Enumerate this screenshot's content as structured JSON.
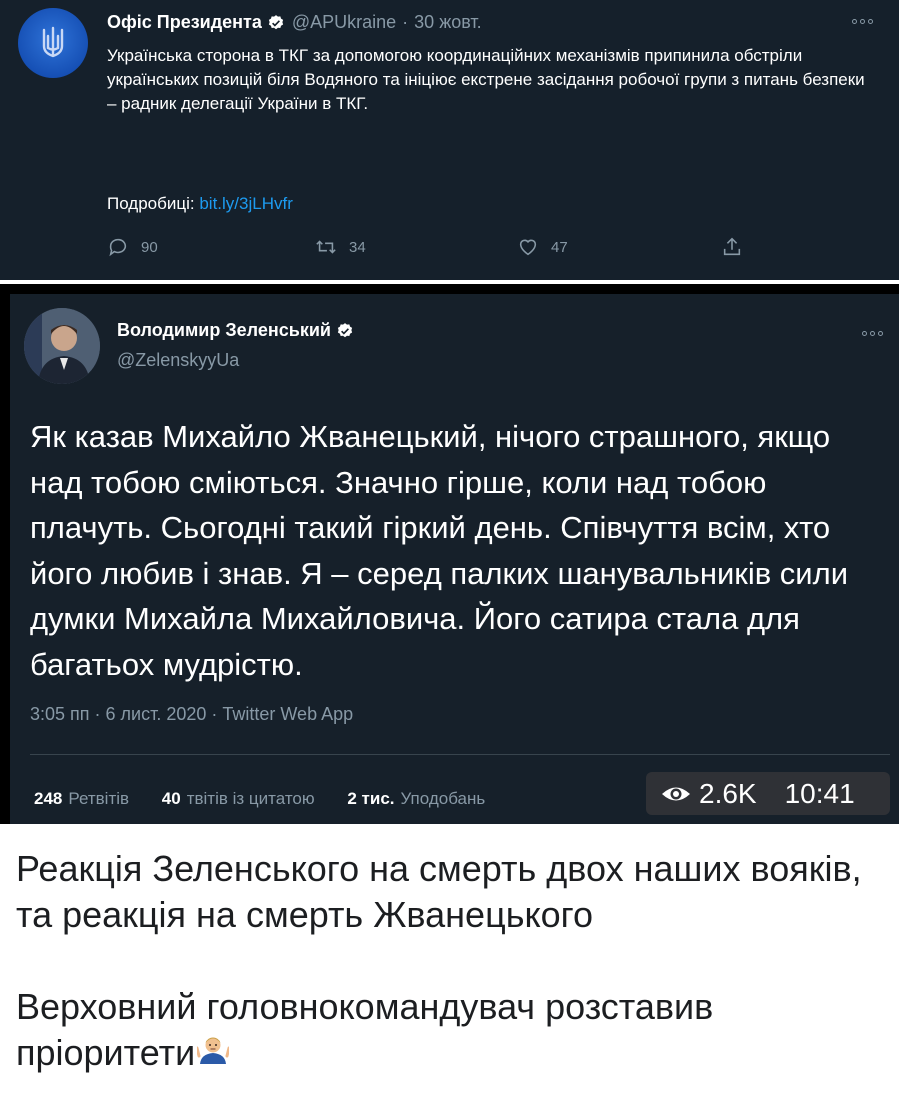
{
  "tweet1": {
    "name": "Офіс Президента",
    "handle": "@APUkraine",
    "separator": "·",
    "date": "30 жовт.",
    "body": "Українська сторона в ТКГ за допомогою координаційних механізмів припинила обстріли українських позицій біля Водяного та ініціює екстрене засідання робочої групи з питань безпеки – радник делегації України в ТКГ.",
    "more_label": "Подробиці:",
    "link": "bit.ly/3jLHvfr",
    "replies": "90",
    "retweets": "34",
    "likes": "47"
  },
  "tweet2": {
    "name": "Володимир Зеленський",
    "handle": "@ZelenskyyUa",
    "body": "Як казав Михайло Жванецький, нічого страшного, якщо над тобою сміються. Значно гірше, коли над тобою плачуть. Сьогодні такий гіркий день. Співчуття всім, хто його любив і знав. Я – серед палких шанувальників сили думки Михайла Михайловича. Його сатира стала для багатьох мудрістю.",
    "meta": "3:05 пп · 6 лист. 2020 · Twitter Web App",
    "retweets_count": "248",
    "retweets_label": "Ретвітів",
    "quotes_count": "40",
    "quotes_label": "твітів із цитатою",
    "likes_count": "2 тис.",
    "likes_label": "Уподобань"
  },
  "overlay": {
    "views": "2.6K",
    "time": "10:41"
  },
  "caption": {
    "line1": "Реакція Зеленського на смерть двох наших вояків, та реакція на смерть Жванецького",
    "line2": "Верховний головнокомандувач розставив пріоритети"
  },
  "colors": {
    "tweet_bg": "#15202b",
    "muted": "#8899a6",
    "link": "#1d9bf0",
    "verified": "#ffffff"
  }
}
